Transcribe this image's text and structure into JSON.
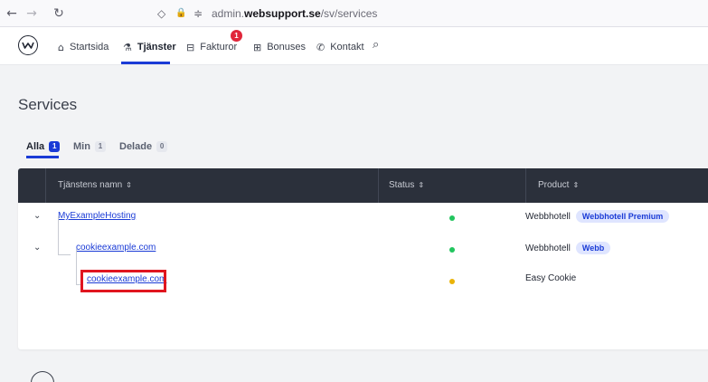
{
  "browser": {
    "back_icon": "←",
    "forward_icon": "→",
    "reload_icon": "↻",
    "shield_icon": "◇",
    "lock_icon": "🔒",
    "perm_icon": "≑",
    "url_prefix": "admin.",
    "url_domain": "websupport.se",
    "url_path": "/sv/services"
  },
  "nav": {
    "items": [
      {
        "label": "Startsida",
        "icon": "⌂"
      },
      {
        "label": "Tjänster",
        "icon": "⚗"
      },
      {
        "label": "Fakturor",
        "icon": "⊟"
      },
      {
        "label": "Bonuses",
        "icon": "⊞"
      },
      {
        "label": "Kontakt",
        "icon": "✆"
      }
    ],
    "notification_count": "1",
    "search_icon": "⌕"
  },
  "page": {
    "title": "Services"
  },
  "tabs": [
    {
      "label": "Alla",
      "count": "1"
    },
    {
      "label": "Min",
      "count": "1"
    },
    {
      "label": "Delade",
      "count": "0"
    }
  ],
  "table": {
    "headers": [
      "Tjänstens namn",
      "Status",
      "Product"
    ],
    "sort_icon": "⇕",
    "chevron_icon": "⌄",
    "rows": [
      {
        "name": "MyExampleHosting",
        "status_color": "#22c55e",
        "product": "Webbhotell",
        "badge": "Webbhotell Premium"
      },
      {
        "name": "cookieexample.com",
        "status_color": "#22c55e",
        "product": "Webbhotell",
        "badge": "Webb"
      },
      {
        "name": "cookieexample.com",
        "status_color": "#eab308",
        "product": "Easy Cookie",
        "badge": ""
      }
    ]
  },
  "colors": {
    "accent": "#1a3bd6",
    "header_dark": "#2b303b",
    "highlight": "#e0151f",
    "notification": "#e0263a"
  }
}
